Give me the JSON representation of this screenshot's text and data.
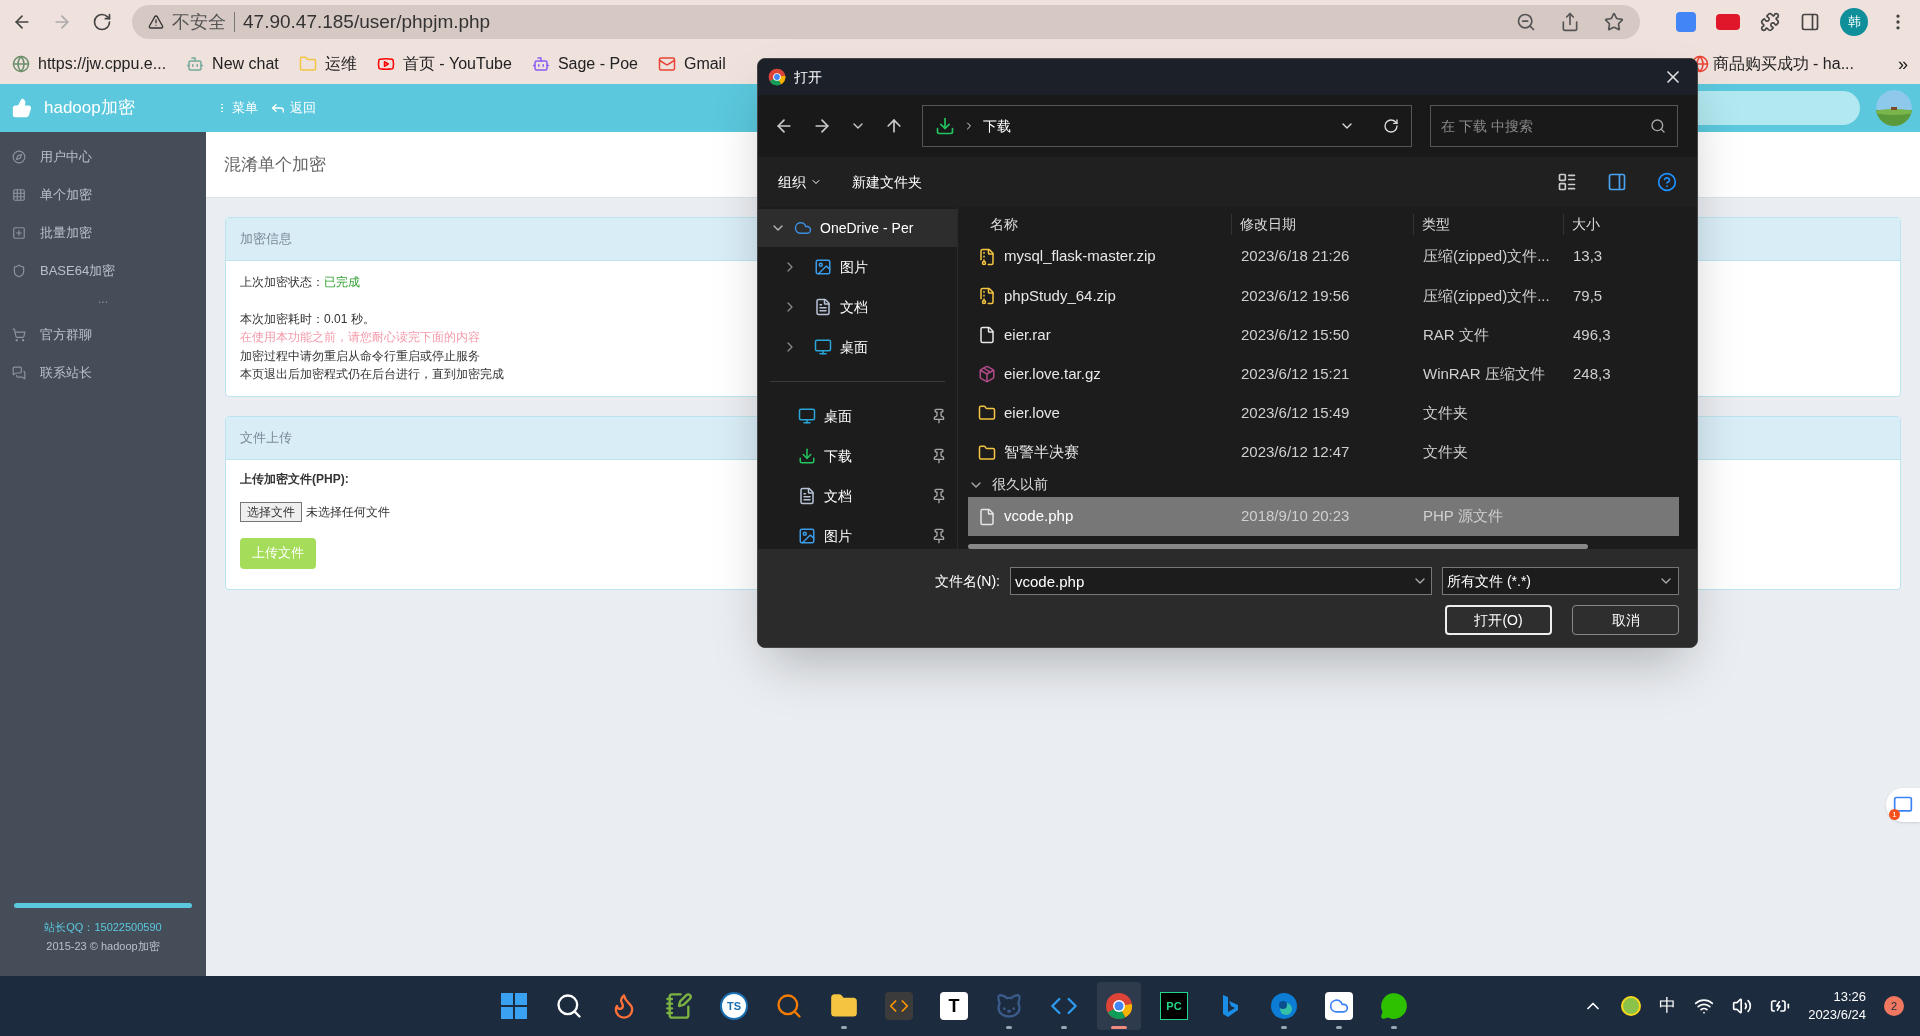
{
  "browser": {
    "security": "不安全",
    "url": "47.90.47.185/user/phpjm.php",
    "profile": "韩",
    "bookmarks": [
      {
        "kind": "globe",
        "label": "https://jw.cppu.e..."
      },
      {
        "kind": "chat",
        "label": "New chat"
      },
      {
        "kind": "folder",
        "label": "运维"
      },
      {
        "kind": "youtube",
        "label": "首页 - YouTube"
      },
      {
        "kind": "poe",
        "label": "Sage - Poe"
      },
      {
        "kind": "gmail",
        "label": "Gmail"
      }
    ],
    "bookmark_right": {
      "kind": "google",
      "label": "商品购买成功 - ha..."
    },
    "more": "»"
  },
  "navbar": {
    "brand": "hadoop加密",
    "menu": "菜单",
    "back": "返回"
  },
  "sidebar": {
    "items": [
      {
        "kind": "compass",
        "label": "用户中心"
      },
      {
        "kind": "grid",
        "label": "单个加密"
      },
      {
        "kind": "plus",
        "label": "批量加密"
      },
      {
        "kind": "shield",
        "label": "BASE64加密"
      },
      {
        "kind": "separator",
        "label": "..."
      },
      {
        "kind": "cart",
        "label": "官方群聊"
      },
      {
        "kind": "chat",
        "label": "联系站长"
      }
    ],
    "footer": [
      "站长QQ：15022500590",
      "2015-23 © hadoop加密"
    ]
  },
  "page_title": "混淆单个加密",
  "info_panel": {
    "title": "加密信息",
    "status_label": "上次加密状态：",
    "status_value": "已完成",
    "lines": [
      {
        "kind": "normal",
        "text": "本次加密耗时：0.01 秒。"
      },
      {
        "kind": "warning",
        "text": "在使用本功能之前，请您耐心读完下面的内容"
      },
      {
        "kind": "normal",
        "text": "加密过程中请勿重启从命令行重启或停止服务"
      },
      {
        "kind": "normal",
        "text": "本页退出后加密程式仍在后台进行，直到加密完成"
      }
    ]
  },
  "upload_panel": {
    "title": "文件上传",
    "label": "上传加密文件(PHP):",
    "choose": "选择文件",
    "no_file": "未选择任何文件",
    "submit": "上传文件"
  },
  "dialog": {
    "title": "打开",
    "path": "下载",
    "search_placeholder": "在 下载 中搜索",
    "organize": "组织",
    "new_folder": "新建文件夹",
    "tree": [
      {
        "kind": "cloud",
        "label": "OneDrive - Per",
        "expanded": true,
        "selected": true,
        "children": [
          {
            "kind": "pictures",
            "label": "图片"
          },
          {
            "kind": "docs",
            "label": "文档"
          },
          {
            "kind": "desktop",
            "label": "桌面"
          }
        ]
      }
    ],
    "quick_access": [
      {
        "kind": "desktop",
        "label": "桌面"
      },
      {
        "kind": "download",
        "label": "下载"
      },
      {
        "kind": "docs",
        "label": "文档"
      },
      {
        "kind": "pictures",
        "label": "图片"
      }
    ],
    "columns": [
      "名称",
      "修改日期",
      "类型",
      "大小"
    ],
    "files": [
      {
        "kind": "zip",
        "name": "mysql_flask-master.zip",
        "date": "2023/6/18 21:26",
        "type": "压缩(zipped)文件...",
        "size": "13,3",
        "selected": false
      },
      {
        "kind": "zip",
        "name": "phpStudy_64.zip",
        "date": "2023/6/12 19:56",
        "type": "压缩(zipped)文件...",
        "size": "79,5",
        "selected": false
      },
      {
        "kind": "file",
        "name": "eier.rar",
        "date": "2023/6/12 15:50",
        "type": "RAR 文件",
        "size": "496,3",
        "selected": false
      },
      {
        "kind": "winrar",
        "name": "eier.love.tar.gz",
        "date": "2023/6/12 15:21",
        "type": "WinRAR 压缩文件",
        "size": "248,3",
        "selected": false
      },
      {
        "kind": "folder",
        "name": "eier.love",
        "date": "2023/6/12 15:49",
        "type": "文件夹",
        "selected": false
      },
      {
        "kind": "folder",
        "name": "智警半决赛",
        "date": "2023/6/12 12:47",
        "type": "文件夹",
        "selected": false
      }
    ],
    "group": {
      "label": "很久以前",
      "expanded": true
    },
    "group_files": [
      {
        "kind": "file",
        "name": "vcode.php",
        "date": "2018/9/10 20:23",
        "type": "PHP 源文件",
        "selected": true
      }
    ],
    "filename_label": "文件名(N):",
    "filename": "vcode.php",
    "filter": "所有文件 (*.*)",
    "open": "打开(O)",
    "cancel": "取消"
  },
  "taskbar": {
    "apps": [
      {
        "kind": "start",
        "running": false,
        "selected": false
      },
      {
        "kind": "search",
        "running": false,
        "selected": false
      },
      {
        "kind": "firefox",
        "running": false,
        "selected": false
      },
      {
        "kind": "notepad",
        "running": false,
        "selected": false
      },
      {
        "kind": "ts",
        "glyph": "TS",
        "running": false,
        "selected": false
      },
      {
        "kind": "magnifier",
        "running": false,
        "selected": false
      },
      {
        "kind": "explorer",
        "running": true,
        "selected": false
      },
      {
        "kind": "sublime",
        "running": false,
        "selected": false
      },
      {
        "kind": "typora",
        "glyph": "T",
        "running": false,
        "selected": false
      },
      {
        "kind": "cat",
        "running": true,
        "selected": false
      },
      {
        "kind": "vscode",
        "running": true,
        "selected": false
      },
      {
        "kind": "chrome",
        "running": true,
        "selected": true
      },
      {
        "kind": "pycharm",
        "glyph": "PC",
        "running": false,
        "selected": false
      },
      {
        "kind": "bing",
        "running": false,
        "selected": false
      },
      {
        "kind": "edge",
        "running": true,
        "selected": false
      },
      {
        "kind": "cloud",
        "running": true,
        "selected": false
      },
      {
        "kind": "wechat",
        "running": true,
        "selected": false
      }
    ],
    "ime": "中",
    "time": "13:26",
    "date": "2023/6/24",
    "notifications": "2"
  },
  "assistant_badge": "1"
}
